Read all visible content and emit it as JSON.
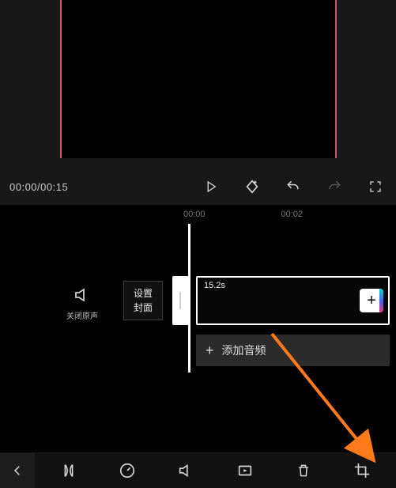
{
  "controls": {
    "time_current": "00:00",
    "time_total": "00:15"
  },
  "ruler": {
    "t0": "00:00",
    "t1": "00:02"
  },
  "timeline": {
    "mute_label": "关闭原声",
    "cover_line1": "设置",
    "cover_line2": "封面",
    "clip_duration": "15.2s",
    "add_audio_label": "添加音频"
  },
  "icons": {
    "play": "play-icon",
    "keyframe": "keyframe-add-icon",
    "undo": "undo-icon",
    "redo": "redo-icon",
    "fullscreen": "fullscreen-icon",
    "mute": "volume-off-icon",
    "plus": "plus-icon",
    "back": "chevron-left-icon",
    "split": "split-icon",
    "speed": "speed-icon",
    "volume": "volume-icon",
    "anim": "animation-icon",
    "delete": "delete-icon",
    "crop": "crop-icon"
  }
}
